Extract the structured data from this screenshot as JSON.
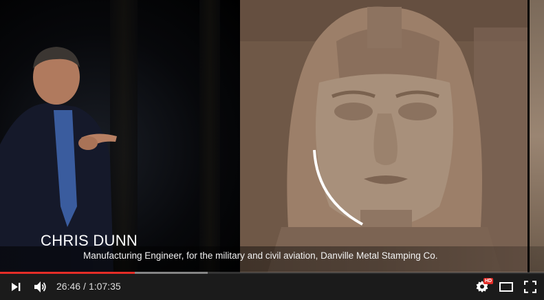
{
  "video": {
    "caption_name": "CHRIS DUNN",
    "caption_subtitle": "Manufacturing Engineer, for the military and civil aviation, Danville Metal Stamping Co."
  },
  "progress": {
    "played_fraction": 0.248,
    "buffered_fraction": 0.382,
    "played_color": "#e52d27"
  },
  "controls": {
    "current_time": "26:46",
    "separator": "/",
    "duration": "1:07:35",
    "hd_badge": "HD",
    "icons": [
      "play-icon",
      "volume-icon",
      "settings-icon",
      "theater-mode-icon",
      "fullscreen-icon"
    ]
  }
}
